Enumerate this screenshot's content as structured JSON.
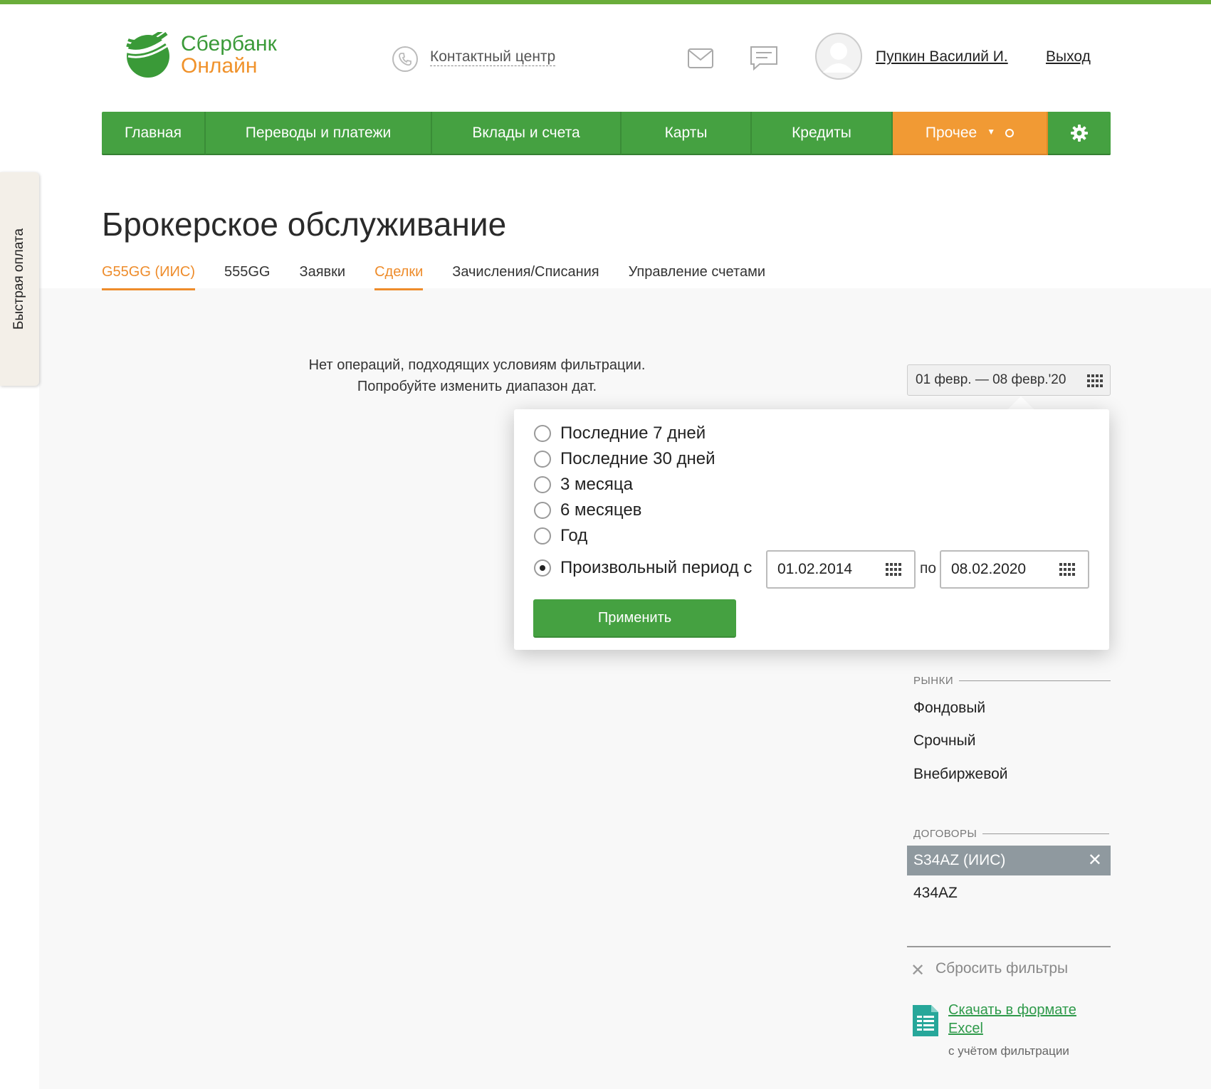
{
  "header": {
    "logo_line1": "Сбербанк",
    "logo_line2": "Онлайн",
    "contact_center": "Контактный центр",
    "user_name": "Пупкин Василий И.",
    "logout": "Выход"
  },
  "nav": {
    "items": [
      "Главная",
      "Переводы и платежи",
      "Вклады и счета",
      "Карты",
      "Кредиты",
      "Прочее"
    ],
    "other_caret": "▼",
    "settings_icon": "gear-icon"
  },
  "quick_pay": "Быстрая оплата",
  "page": {
    "title": "Брокерское обслуживание",
    "tabs": [
      "G55GG (ИИС)",
      "555GG",
      "Заявки",
      "Сделки",
      "Зачисления/Списания",
      "Управление счетами"
    ]
  },
  "empty_message": {
    "line1": "Нет операций, подходящих условиям фильтрации.",
    "line2": "Попробуйте изменить диапазон дат."
  },
  "date_range": "01 февр. — 08 февр.'20",
  "period_popup": {
    "options": [
      "Последние 7 дней",
      "Последние 30 дней",
      "3 месяца",
      "6 месяцев",
      "Год",
      "Произвольный период с"
    ],
    "selected_index": 5,
    "from_date": "01.02.2014",
    "to_label": "по",
    "to_date": "08.02.2020",
    "apply_label": "Применить"
  },
  "filters": {
    "markets_heading": "РЫНКИ",
    "markets": [
      "Фондовый",
      "Срочный",
      "Внебиржевой"
    ],
    "contracts_heading": "ДОГОВОРЫ",
    "selected_contract": "S34AZ (ИИС)",
    "contracts": [
      "434AZ"
    ],
    "reset_label": "Сбросить фильтры",
    "excel_link": "Скачать в формате Excel",
    "excel_sub": "с учётом фильтрации"
  },
  "colors": {
    "brand_green": "#45a141",
    "brand_orange": "#f19a34",
    "tab_active": "#ee8c2b"
  }
}
